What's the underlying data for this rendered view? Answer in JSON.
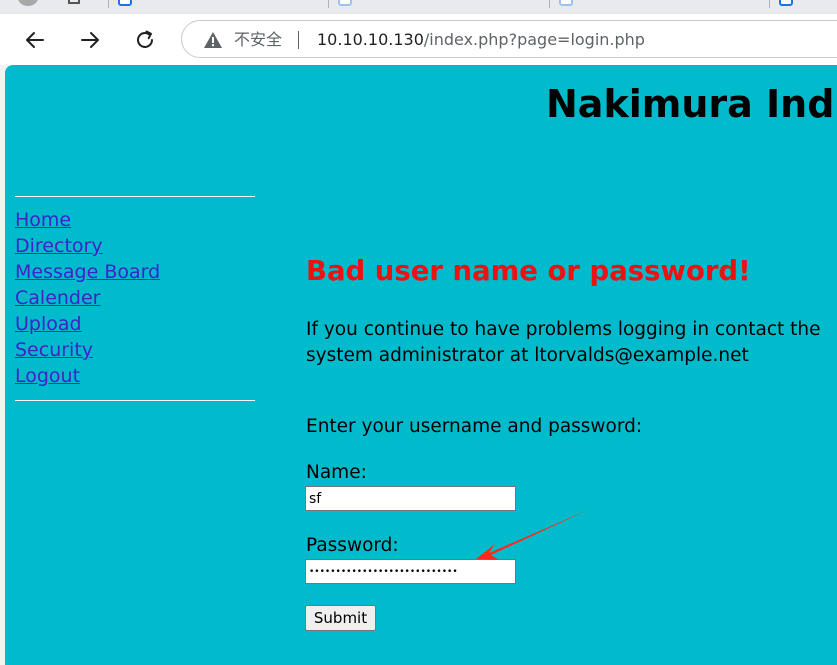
{
  "browser": {
    "nav_icons": [
      "back-arrow-icon",
      "forward-arrow-icon",
      "reload-icon"
    ],
    "security_icon": "warning-triangle-icon",
    "security_label": "不安全",
    "url_host": "10.10.10.130",
    "url_path": "/index.php?page=login.php"
  },
  "page": {
    "site_title": "Nakimura Indu",
    "background_color": "#00bbcc",
    "sidebar": {
      "items": [
        {
          "label": "Home"
        },
        {
          "label": "Directory"
        },
        {
          "label": "Message Board"
        },
        {
          "label": "Calender"
        },
        {
          "label": "Upload"
        },
        {
          "label": "Security"
        },
        {
          "label": "Logout"
        }
      ],
      "link_color": "#3f23c8"
    },
    "error_heading": "Bad user name or password!",
    "error_color": "#ee1111",
    "help_text": "If you continue to have problems logging in contact the system administrator at ltorvalds@example.net",
    "prompt": "Enter your username and password:",
    "form": {
      "name_label": "Name:",
      "name_value": "sf",
      "password_label": "Password:",
      "password_value": "••••••••••••••••••••••••••••",
      "submit_label": "Submit"
    },
    "annotation": {
      "icon": "red-arrow-annotation-icon",
      "color": "#ff2a1a"
    }
  }
}
